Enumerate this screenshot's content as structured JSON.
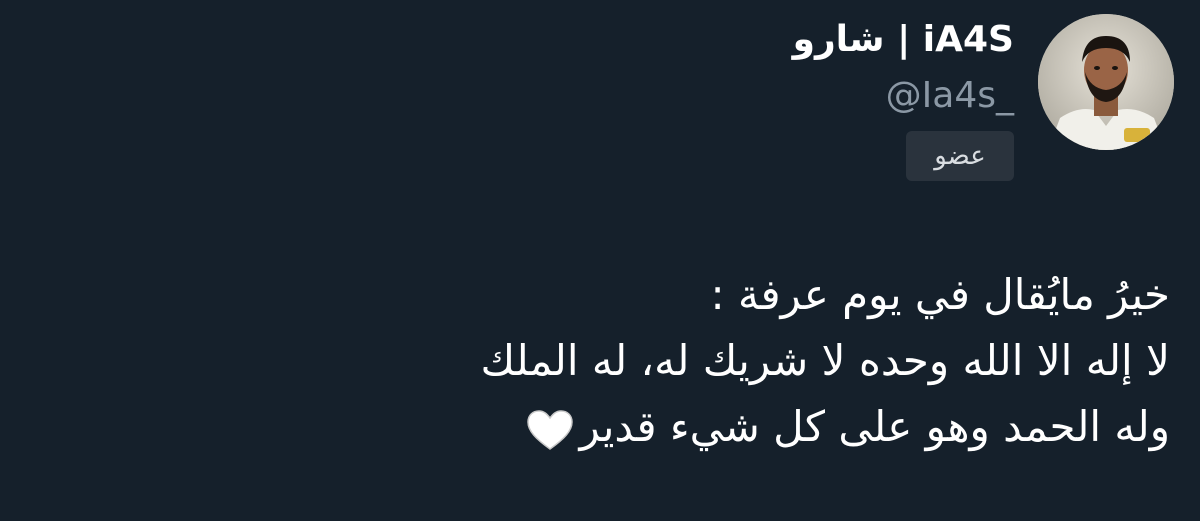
{
  "tweet": {
    "author": {
      "display_name": "شارو | iA4S",
      "handle": "@Ia4s_",
      "badge_label": "عضو",
      "avatar_icon": "user-avatar-photo"
    },
    "text_lines": [
      "خيرُ مايُقال في يوم عرفة :",
      "لا إله الا الله وحده لا شريك له، له الملك",
      "وله الحمد وهو على كل شيء قدير"
    ],
    "trailing_emoji": "white-heart-icon"
  },
  "colors": {
    "background": "#15202b",
    "primary_text": "#ffffff",
    "secondary_text": "#8b98a5",
    "badge_bg": "#2a333d"
  }
}
